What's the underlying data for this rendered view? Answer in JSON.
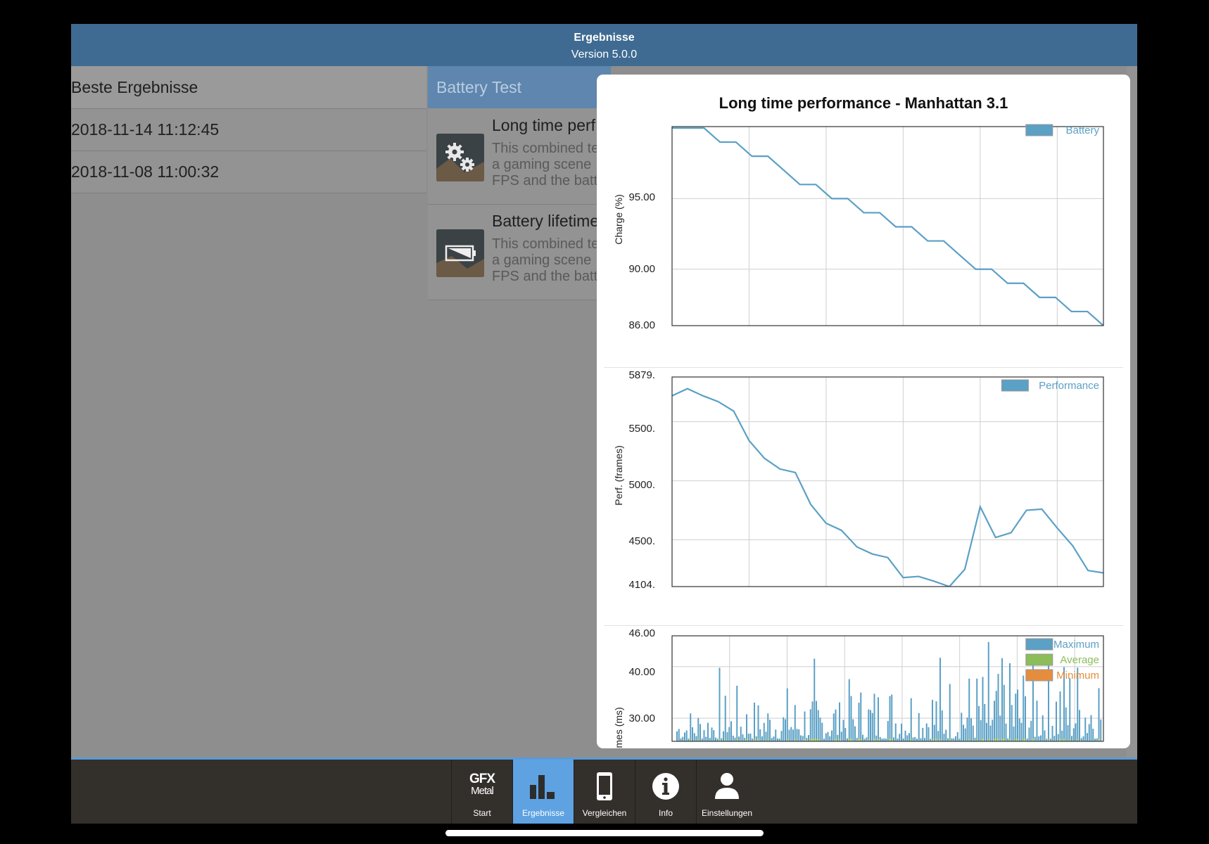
{
  "header": {
    "title": "Ergebnisse",
    "version": "Version 5.0.0"
  },
  "results": {
    "header": "Beste Ergebnisse",
    "items": [
      "2018-11-14 11:12:45",
      "2018-11-08 11:00:32"
    ]
  },
  "tests": {
    "header": "Battery Test",
    "items": [
      {
        "title": "Long time perf",
        "desc": [
          "This combined te",
          "a gaming scene",
          "FPS and the batt"
        ],
        "icon": "gears-icon"
      },
      {
        "title": "Battery lifetime",
        "desc": [
          "This combined te",
          "a gaming scene",
          "FPS and the batt"
        ],
        "icon": "battery-icon"
      }
    ]
  },
  "popup": {
    "title": "Long time performance - Manhattan 3.1"
  },
  "chart_data": [
    {
      "type": "line",
      "ylabel": "Charge (%)",
      "yticks": [
        "95.00",
        "90.00",
        "86.00"
      ],
      "ylim": [
        86,
        100.1
      ],
      "grid": true,
      "legend_position": "top-right",
      "series": [
        {
          "name": "Battery",
          "color": "#5ba0c5",
          "values": [
            100,
            100,
            100,
            99,
            99,
            98,
            98,
            97,
            96,
            96,
            95,
            95,
            94,
            94,
            93,
            93,
            92,
            92,
            91,
            90,
            90,
            89,
            89,
            88,
            88,
            87,
            87,
            86
          ]
        }
      ]
    },
    {
      "type": "line",
      "ylabel": "Perf. (frames)",
      "yticks": [
        "5879.",
        "5500.",
        "5000.",
        "4500.",
        "4104."
      ],
      "ylim": [
        4104,
        5879
      ],
      "grid": true,
      "legend_position": "top-right",
      "series": [
        {
          "name": "Performance",
          "color": "#5ba0c5",
          "values": [
            5720,
            5780,
            5720,
            5670,
            5590,
            5340,
            5190,
            5100,
            5070,
            4800,
            4640,
            4580,
            4440,
            4380,
            4350,
            4180,
            4190,
            4150,
            4104,
            4250,
            4780,
            4520,
            4560,
            4750,
            4760,
            4600,
            4450,
            4240,
            4220
          ]
        }
      ]
    },
    {
      "type": "bar",
      "ylabel": "imes (ms)",
      "yticks": [
        "46.00",
        "40.00",
        "30.00"
      ],
      "ylim": [
        25.5,
        46
      ],
      "grid": true,
      "legend_position": "top-right",
      "series": [
        {
          "name": "Maximum",
          "color": "#5ba0c5"
        },
        {
          "name": "Average",
          "color": "#8cbd58"
        },
        {
          "name": "Minimum",
          "color": "#e58d3e"
        }
      ]
    }
  ],
  "tabbar": {
    "items": [
      {
        "label": "Start",
        "logo_top": "GFX",
        "logo_bottom": "Metal",
        "active": false
      },
      {
        "label": "Ergebnisse",
        "active": true
      },
      {
        "label": "Vergleichen",
        "active": false
      },
      {
        "label": "Info",
        "active": false
      },
      {
        "label": "Einstellungen",
        "active": false
      }
    ]
  }
}
